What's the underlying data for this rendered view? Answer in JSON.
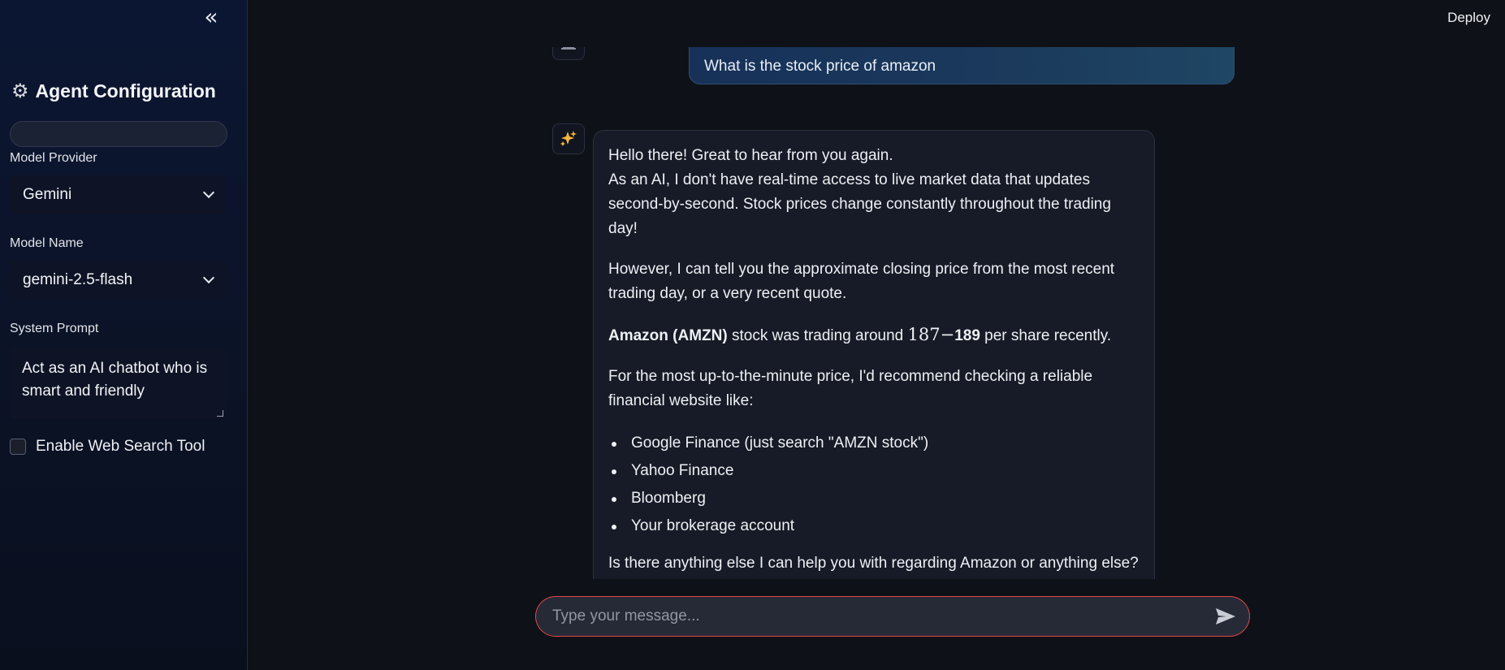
{
  "sidebar": {
    "collapse_icon": "«",
    "title": "Agent Configuration",
    "model_provider_label": "Model Provider",
    "model_provider_value": "Gemini",
    "model_name_label": "Model Name",
    "model_name_value": "gemini-2.5-flash",
    "system_prompt_label": "System Prompt",
    "system_prompt_value": "Act as an AI chatbot who is smart and friendly",
    "web_search_label": "Enable Web Search Tool",
    "web_search_checked": false
  },
  "topbar": {
    "deploy_label": "Deploy"
  },
  "chat": {
    "user_message": "What is the stock price of amazon",
    "assistant": {
      "line1": "Hello there! Great to hear from you again.",
      "line2": "As an AI, I don't have real-time access to live market data that updates second-by-second. Stock prices change constantly throughout the trading day!",
      "para2": "However, I can tell you the approximate closing price from the most recent trading day, or a very recent quote.",
      "para3_bold": "Amazon (AMZN)",
      "para3_mid": " stock was trading around ",
      "para3_math": "187−",
      "para3_bold2": "189",
      "para3_end": " per share recently.",
      "para4": "For the most up-to-the-minute price, I'd recommend checking a reliable financial website like:",
      "list": [
        "Google Finance (just search \"AMZN stock\")",
        "Yahoo Finance",
        "Bloomberg",
        "Your brokerage account"
      ],
      "para5": "Is there anything else I can help you with regarding Amazon or anything else?",
      "emoji": "😊"
    }
  },
  "input": {
    "placeholder": "Type your message..."
  },
  "colors": {
    "accent_border": "#e04848",
    "user_bubble": "#1b3a5c",
    "background": "#0e1117"
  },
  "icons": {
    "gear": "gear-icon",
    "user_avatar": "user-avatar-icon",
    "assistant_avatar": "sparkles-icon",
    "send": "send-icon",
    "chevron": "chevron-down-icon",
    "collapse": "double-chevron-left-icon"
  }
}
